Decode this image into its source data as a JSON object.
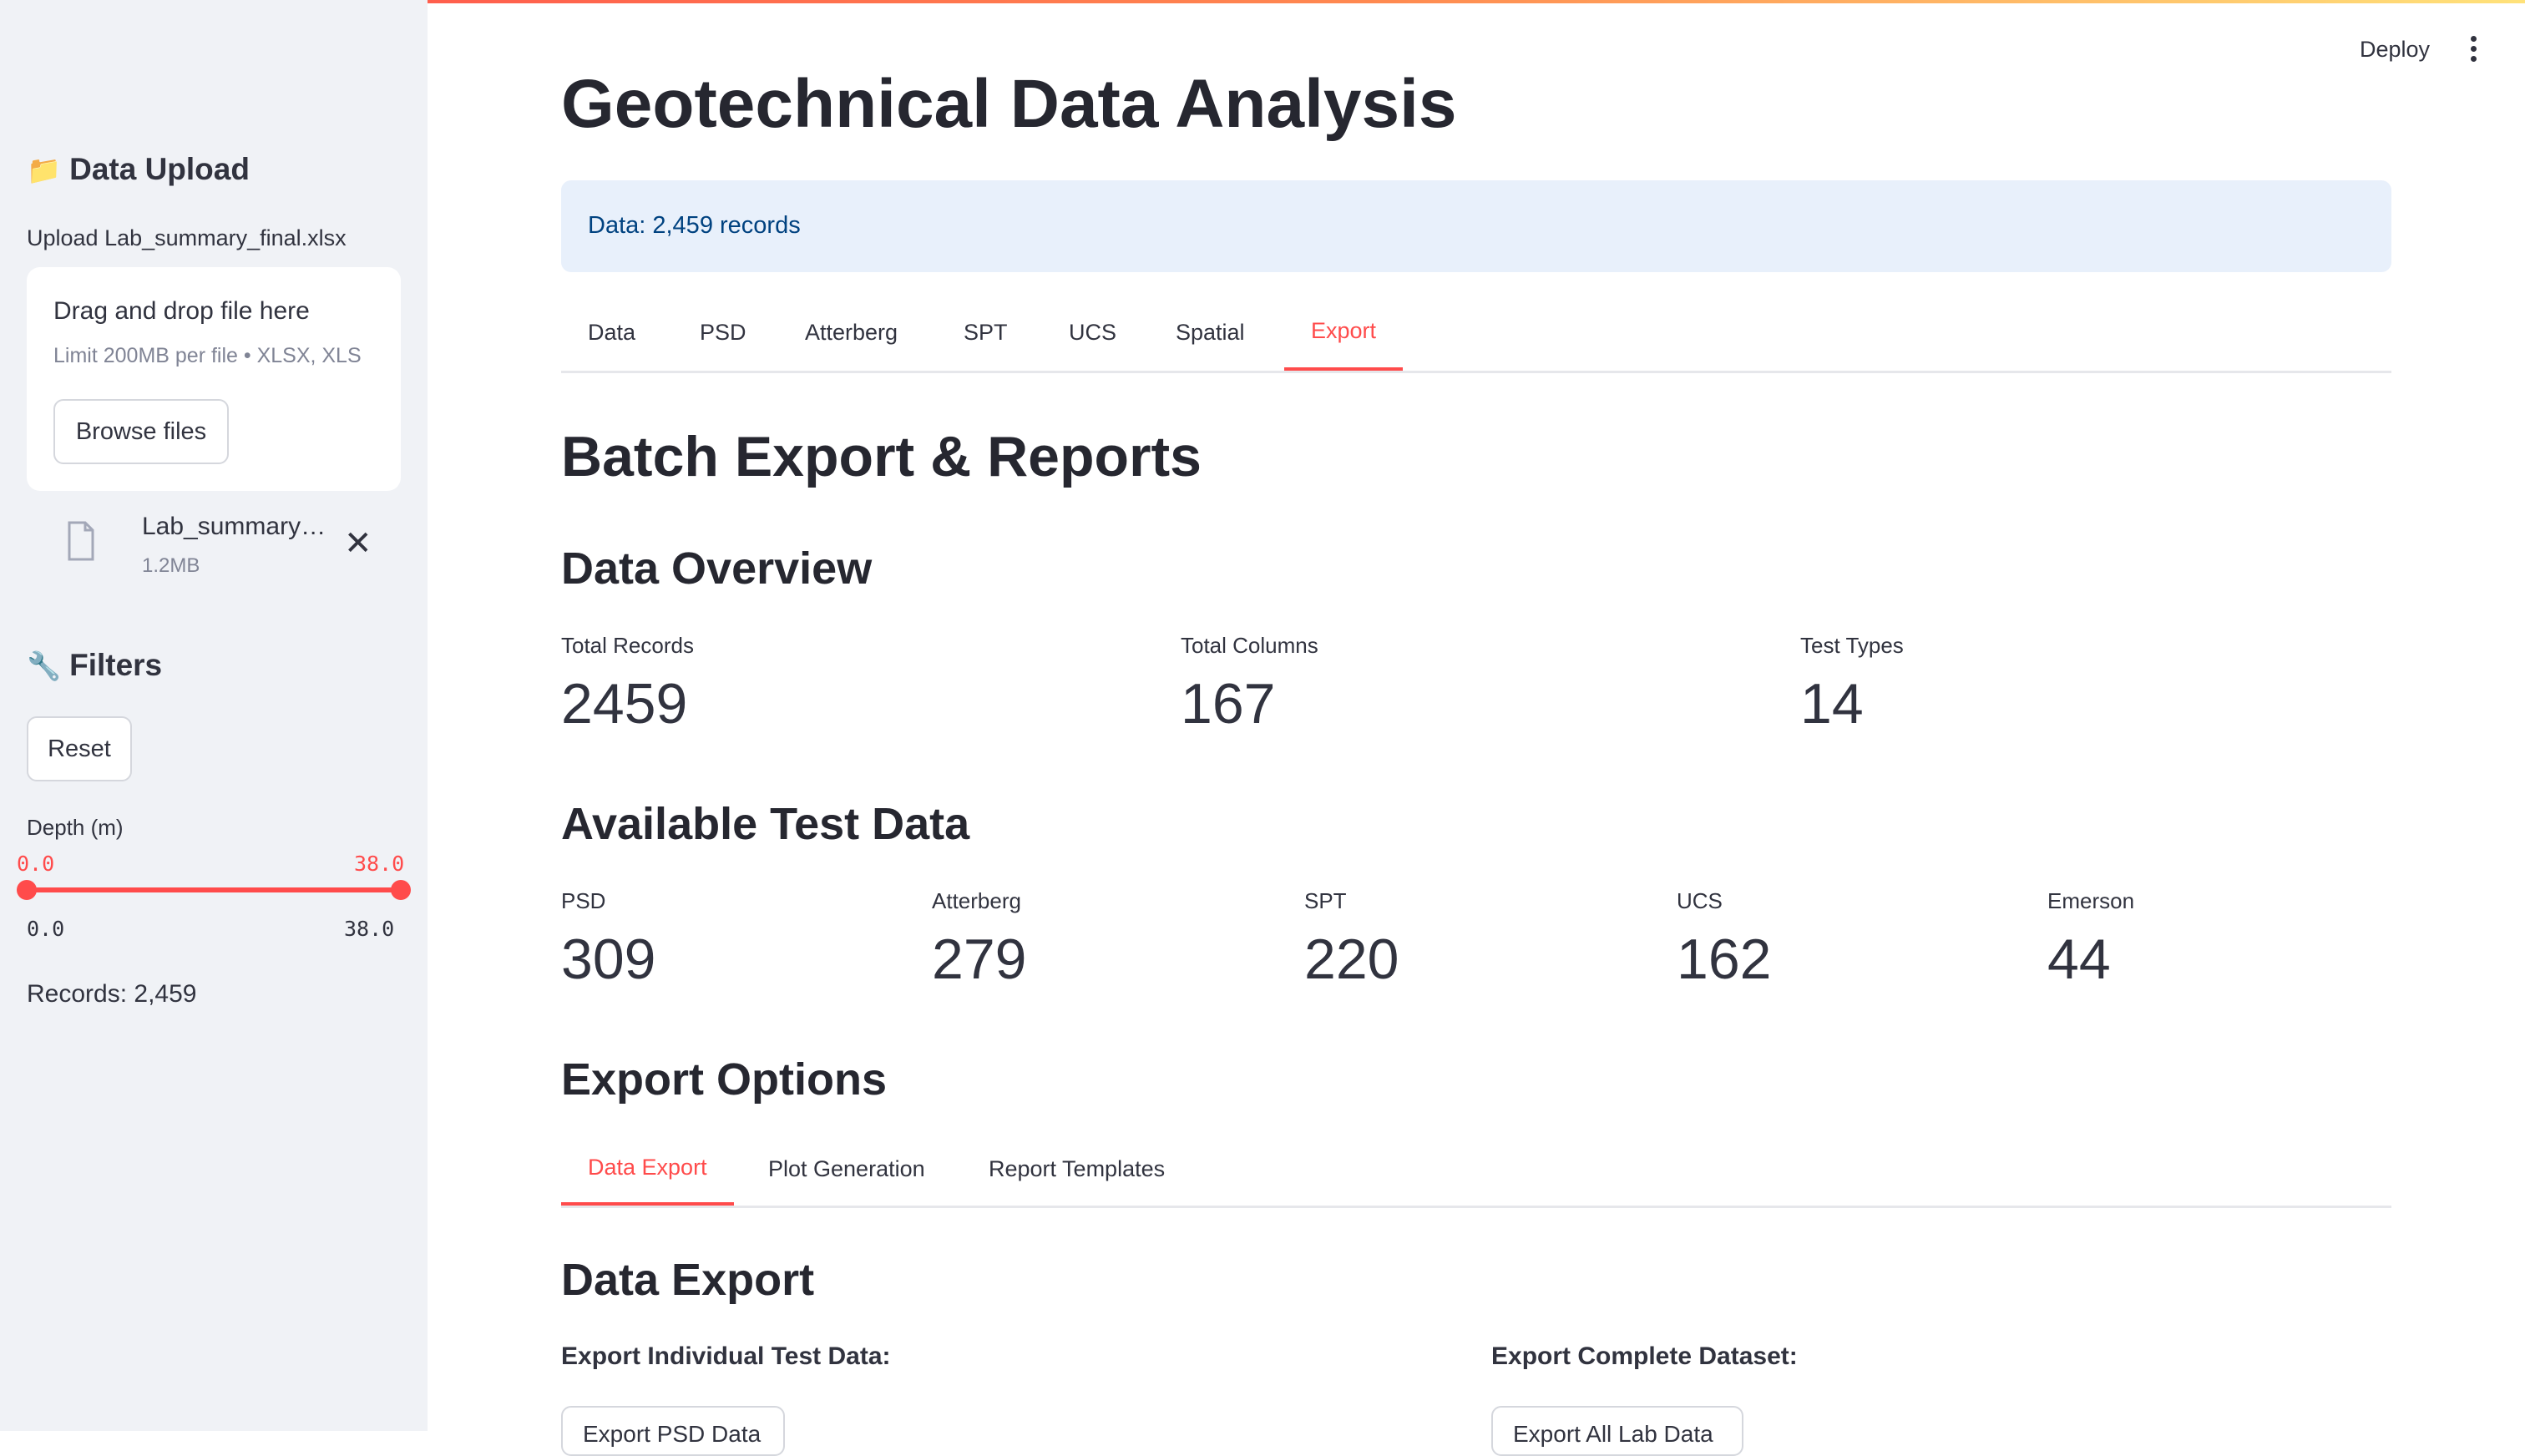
{
  "header": {
    "deploy_label": "Deploy"
  },
  "sidebar": {
    "upload": {
      "heading": "Data Upload",
      "label": "Upload Lab_summary_final.xlsx",
      "drop_title": "Drag and drop file here",
      "limit_text": "Limit 200MB per file • XLSX, XLS",
      "browse_label": "Browse files",
      "file_name": "Lab_summary…",
      "file_size": "1.2MB"
    },
    "filters": {
      "heading": "Filters",
      "reset_label": "Reset",
      "slider_label": "Depth (m)",
      "slider_low": "0.0",
      "slider_high": "38.0",
      "slider_min": "0.0",
      "slider_max": "38.0",
      "records_text": "Records: 2,459"
    }
  },
  "main": {
    "title": "Geotechnical Data Analysis",
    "info_text": "Data: 2,459 records",
    "tabs": [
      "Data",
      "PSD",
      "Atterberg",
      "SPT",
      "UCS",
      "Spatial",
      "Export"
    ],
    "active_tab": "Export",
    "section_title": "Batch Export & Reports",
    "overview": {
      "heading": "Data Overview",
      "metrics": [
        {
          "label": "Total Records",
          "value": "2459"
        },
        {
          "label": "Total Columns",
          "value": "167"
        },
        {
          "label": "Test Types",
          "value": "14"
        }
      ]
    },
    "available": {
      "heading": "Available Test Data",
      "metrics": [
        {
          "label": "PSD",
          "value": "309"
        },
        {
          "label": "Atterberg",
          "value": "279"
        },
        {
          "label": "SPT",
          "value": "220"
        },
        {
          "label": "UCS",
          "value": "162"
        },
        {
          "label": "Emerson",
          "value": "44"
        }
      ]
    },
    "export_options": {
      "heading": "Export Options",
      "tabs": [
        "Data Export",
        "Plot Generation",
        "Report Templates"
      ],
      "active_tab": "Data Export"
    },
    "data_export": {
      "heading": "Data Export",
      "individual_label": "Export Individual Test Data:",
      "complete_label": "Export Complete Dataset:",
      "individual_button": "Export PSD Data",
      "complete_button": "Export All Lab Data"
    }
  },
  "colors": {
    "accent": "#ff4b4b",
    "sidebar_bg": "#f0f2f6",
    "info_bg": "#e8f0fb",
    "info_text": "#004280"
  },
  "icons": {
    "upload_heading": "folder-icon",
    "filters_heading": "wrench-icon",
    "file": "file-icon",
    "remove": "close-icon",
    "menu": "kebab-menu-icon"
  }
}
